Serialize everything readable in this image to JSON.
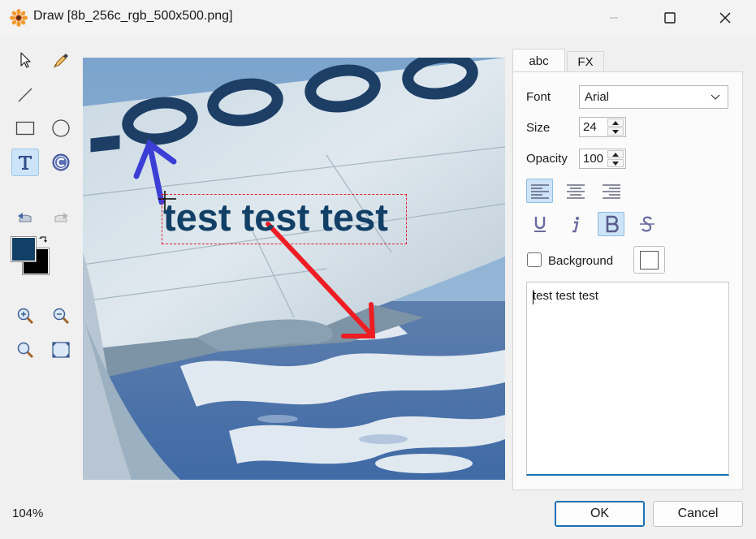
{
  "window": {
    "title": "Draw [8b_256c_rgb_500x500.png]"
  },
  "toolbar": {
    "tools": [
      "select-arrow",
      "eyedropper",
      "line",
      "rectangle",
      "ellipse",
      "text",
      "stamp",
      "undo",
      "redo",
      "zoom-in",
      "zoom-out",
      "zoom-actual",
      "fit-window"
    ],
    "active_tool": "text",
    "foreground_color": "#123f66",
    "background_color": "#000000"
  },
  "canvas": {
    "overlay_text": "test test test",
    "text_color": "#123f66",
    "arrow_colors": {
      "blue": "#3b3fd6",
      "red": "#ee1d24"
    },
    "frame_color": "#e0242c"
  },
  "panel": {
    "tabs": [
      {
        "label": "abc",
        "active": true
      },
      {
        "label": "FX",
        "active": false
      }
    ],
    "font": {
      "label": "Font",
      "value": "Arial"
    },
    "size": {
      "label": "Size",
      "value": "24"
    },
    "opacity": {
      "label": "Opacity",
      "value": "100"
    },
    "alignment": {
      "selected": "left",
      "options": [
        "left",
        "center",
        "right"
      ]
    },
    "styles": {
      "underline": false,
      "italic": false,
      "bold": true,
      "strikethrough": false
    },
    "background": {
      "label": "Background",
      "checked": false,
      "color": "#ffffff"
    },
    "text_value": "test test test"
  },
  "status": {
    "zoom": "104%"
  },
  "buttons": {
    "ok": "OK",
    "cancel": "Cancel"
  }
}
